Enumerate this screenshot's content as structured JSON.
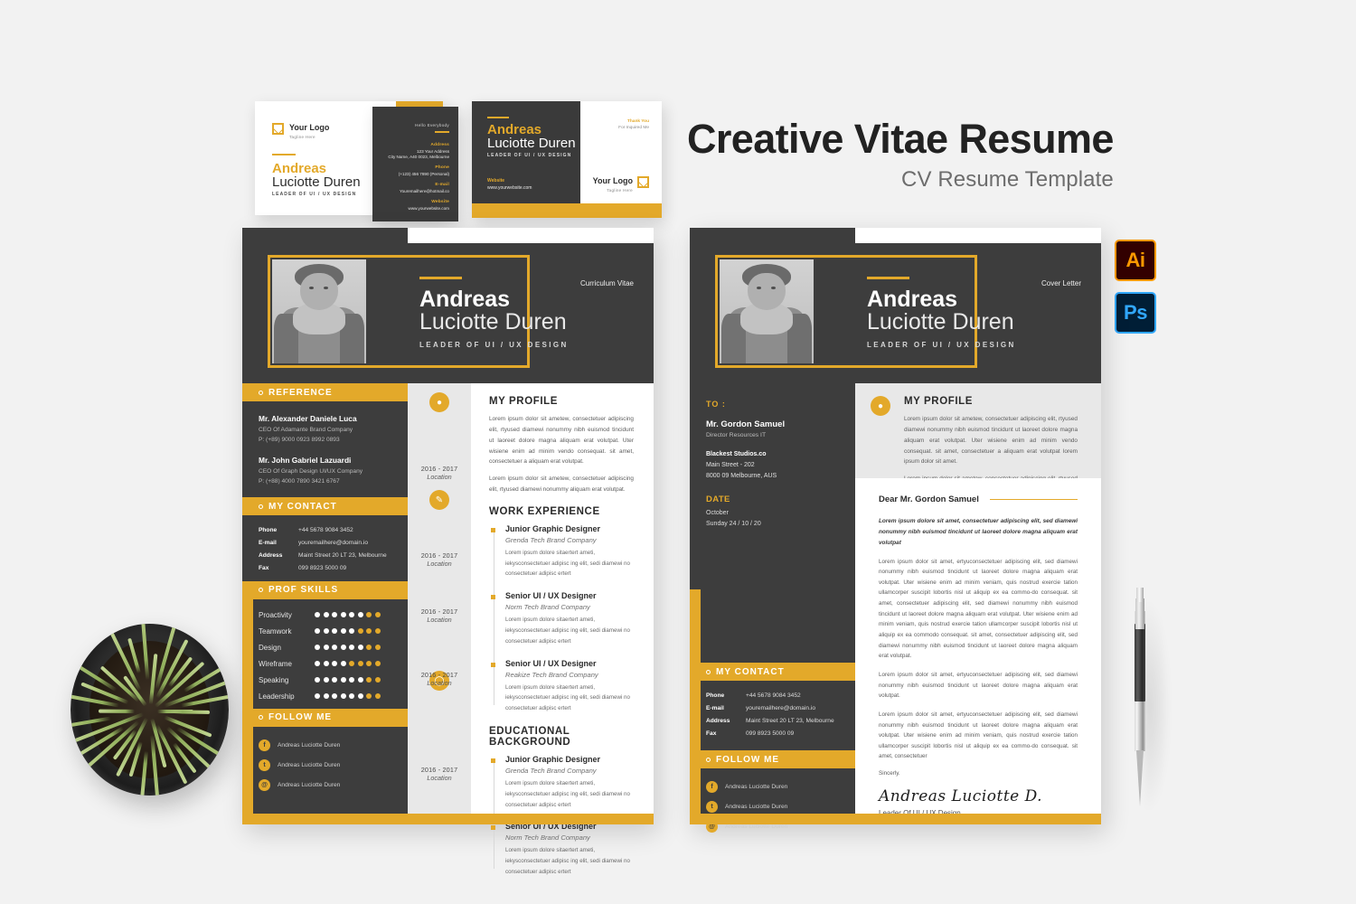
{
  "headline": {
    "title": "Creative Vitae Resume",
    "subtitle": "CV Resume Template"
  },
  "badges": [
    {
      "name": "illustrator-badge",
      "label": "Ai",
      "color": "#ff9a00"
    },
    {
      "name": "photoshop-badge",
      "label": "Ps",
      "color": "#31a8ff"
    }
  ],
  "brand": {
    "accent": "#e3a92a",
    "dark": "#3d3d3d",
    "light_gray": "#e8e8e8",
    "page_bg": "#f2f2f2"
  },
  "business_cards": {
    "front": {
      "logo_title": "Your Logo",
      "logo_tagline": "Tagline Here",
      "first_name": "Andreas",
      "last_name": "Luciotte Duren",
      "role": "LEADER OF UI / UX DESIGN"
    },
    "back_dark": {
      "hello": "Hello Everybody",
      "fields": [
        {
          "label": "Address",
          "value": "123 Your Address\nCity Name, A40 0023, Melbourne"
        },
        {
          "label": "Phone",
          "value": "(+123) 456 7890 (Personal)"
        },
        {
          "label": "E-mail",
          "value": "Youremailhere@hotmail.co"
        },
        {
          "label": "Website",
          "value": "www.yourwebsite.com"
        }
      ]
    },
    "wide": {
      "first_name": "Andreas",
      "last_name": "Luciotte Duren",
      "role": "LEADER OF UI / UX DESIGN",
      "website_label": "Website",
      "website_value": "www.yourwebsite.com",
      "thanks_line1": "Thank You",
      "thanks_line2": "For Inquired Me",
      "logo_title": "Your Logo",
      "logo_tagline": "Tagline Here"
    }
  },
  "cv": {
    "kicker": "Curriculum Vitae",
    "first_name": "Andreas",
    "last_name": "Luciotte Duren",
    "role": "LEADER OF UI / UX DESIGN",
    "sections": {
      "reference": "REFERENCE",
      "contact": "MY CONTACT",
      "skills": "PROF SKILLS",
      "follow": "FOLLOW ME",
      "profile": "MY PROFILE",
      "work": "WORK EXPERIENCE",
      "education": "EDUCATIONAL BACKGROUND"
    },
    "references": [
      {
        "name": "Mr. Alexander Daniele Luca",
        "role": "CEO Of Adamante Brand Company",
        "phone": "P: (+89) 9000 0923 8992 0893"
      },
      {
        "name": "Mr. John Gabriel Lazuardi",
        "role": "CEO Of Graph Design UI/UX Company",
        "phone": "P: (+88) 4000 7890 3421 6767"
      }
    ],
    "contact": [
      {
        "key": "Phone",
        "value": "+44 5678 9084 3452"
      },
      {
        "key": "E-mail",
        "value": "youremailhere@domain.io"
      },
      {
        "key": "Address",
        "value": "Maint Street 20 LT 23, Melbourne"
      },
      {
        "key": "Fax",
        "value": "099 8923 5000 09"
      }
    ],
    "skills": [
      {
        "name": "Proactivity",
        "filled": 6,
        "total": 8
      },
      {
        "name": "Teamwork",
        "filled": 5,
        "total": 8
      },
      {
        "name": "Design",
        "filled": 6,
        "total": 8
      },
      {
        "name": "Wireframe",
        "filled": 4,
        "total": 8
      },
      {
        "name": "Speaking",
        "filled": 6,
        "total": 8
      },
      {
        "name": "Leadership",
        "filled": 6,
        "total": 8
      }
    ],
    "follow": [
      {
        "icon": "facebook-icon",
        "glyph": "f",
        "handle": "Andreas Luciotte Duren"
      },
      {
        "icon": "twitter-icon",
        "glyph": "t",
        "handle": "Andreas Luciotte Duren"
      },
      {
        "icon": "instagram-icon",
        "glyph": "@",
        "handle": "Andreas Luciotte Duren"
      }
    ],
    "profile_paragraphs": [
      "Lorem ipsum dolor sit ametew, consectetuer adipiscing elit, rtyused diamewi nonummy nibh euismod tincidunt ut laoreet dolore magna aliquam erat volutpat. Uter wisiene enim ad minim vendo consequat. sit amet, consectetuer a aliquam erat volutpat.",
      "Lorem ipsum dolor sit ametew, consectetuer adipiscing elit, rtyused diamewi nonummy aliquam erat volutpat."
    ],
    "work": [
      {
        "title": "Junior Graphic Designer",
        "company": "Grenda Tech Brand Company",
        "desc": "Lorem ipsum dolore sitaertert ameti, iekysconsectetuer adipisc ing elit, sedi diamewi no consectetuer adipisc ertert"
      },
      {
        "title": "Senior UI / UX Designer",
        "company": "Norm Tech Brand Company",
        "desc": "Lorem ipsum dolore sitaertert ameti, iekysconsectetuer adipisc ing elit, sedi diamewi no consectetuer adipisc ertert"
      },
      {
        "title": "Senior UI / UX Designer",
        "company": "Reakize Tech Brand Company",
        "desc": "Lorem ipsum dolore sitaertert ameti, iekysconsectetuer adipisc ing elit, sedi diamewi no consectetuer adipisc ertert"
      }
    ],
    "education": [
      {
        "title": "Junior Graphic Designer",
        "company": "Grenda Tech Brand Company",
        "desc": "Lorem ipsum dolore sitaertert ameti, iekysconsectetuer adipisc ing elit, sedi diamewi no consectetuer adipisc ertert"
      },
      {
        "title": "Senior UI / UX Designer",
        "company": "Norm Tech Brand Company",
        "desc": "Lorem ipsum dolore sitaertert ameti, iekysconsectetuer adipisc ing elit, sedi diamewi no consectetuer adipisc ertert"
      }
    ],
    "timeline": [
      {
        "year": "2016 - 2017",
        "location": "Location"
      },
      {
        "year": "2016 - 2017",
        "location": "Location"
      },
      {
        "year": "2016 - 2017",
        "location": "Location"
      },
      {
        "year": "2016 - 2017",
        "location": "Location"
      },
      {
        "year": "2016 - 2017",
        "location": "Location"
      }
    ]
  },
  "cover_letter": {
    "kicker": "Cover Letter",
    "first_name": "Andreas",
    "last_name": "Luciotte Duren",
    "role": "LEADER OF UI / UX DESIGN",
    "to_label": "TO :",
    "recipient_name": "Mr. Gordon Samuel",
    "recipient_role": "Director Resources IT",
    "company": "Blackest Studios.co",
    "address_line1": "Main Street - 202",
    "address_line2": "8000 09 Melbourne, AUS",
    "date_label": "DATE",
    "date_month": "October",
    "date_full": "Sunday 24 / 10 / 20",
    "sections": {
      "profile": "MY PROFILE",
      "contact": "MY CONTACT",
      "follow": "FOLLOW ME"
    },
    "profile_paragraphs": [
      "Lorem ipsum dolor sit ametew, consectetuer adipiscing elit, rtyused diamewi nonummy nibh euismod tincidunt ut laoreet dolore magna aliquam erat volutpat. Uter wisiene enim ad minim vendo consequat. sit amet, consectetuer a aliquam erat volutpat lorem ipsum dolor sit amet.",
      "Lorem ipsum dolor sit ametew, consectetuer adipiscing elit, rtyused diamewi nonummy aliquam erat volutpat lorem ipsum dolor."
    ],
    "greeting": "Dear Mr. Gordon Samuel",
    "lead_paragraph": "Lorem ipsum dolore sit amet, consectetuer adipiscing elit, sed diamewi nonummy nibh euismod tincidunt ut laoreet dolore magna aliquam erat volutpat",
    "body_paragraphs": [
      "Lorem ipsum dolor sit amet, ertyuconsectetuer adipiscing elit, sed diamewi nonummy nibh euismod tincidunt ut laoreet dolore magna aliquam erat volutpat. Uter wisiene enim ad minim veniam, quis nostrud exercie tation ullamcorper suscipit lobortis nisl ut aliquip ex ea commo-do consequat. sit amet, consectetuer adipiscing elit, sed diamewi nonummy nibh euismod tincidunt ut laoreet dolore magna aliquam erat volutpat. Uter wisiene enim ad minim veniam, quis nostrud exercie tation ullamcorper suscipit lobortis nisl ut aliquip ex ea commodo consequat.  sit amet, consectetuer adipiscing elit, sed diamewi nonummy nibh euismod tincidunt ut laoreet dolore magna aliquam erat volutpat.",
      "Lorem ipsum dolor sit amet, ertyuconsectetuer adipiscing elit, sed diamewi nonummy nibh euismod tincidunt ut laoreet dolore magna aliquam erat volutpat.",
      "Lorem ipsum dolor sit amet, ertyuconsectetuer adipiscing elit, sed diamewi nonummy nibh euismod tincidunt ut laoreet dolore magna aliquam erat volutpat. Uter wisiene enim ad minim veniam, quis nostrud exercie tation ullamcorper suscipit lobortis nisl ut aliquip ex ea commo-do consequat. sit amet, consectetuer"
    ],
    "sincerely": "Sincerly.",
    "signature": "Andreas Luciotte D.",
    "signature_role": "Leader Of UI / UX Design",
    "contact": [
      {
        "key": "Phone",
        "value": "+44 5678 9084 3452"
      },
      {
        "key": "E-mail",
        "value": "youremailhere@domain.io"
      },
      {
        "key": "Address",
        "value": "Maint Street 20 LT 23, Melbourne"
      },
      {
        "key": "Fax",
        "value": "099 8923 5000 09"
      }
    ],
    "follow": [
      {
        "icon": "facebook-icon",
        "glyph": "f",
        "handle": "Andreas Luciotte Duren"
      },
      {
        "icon": "twitter-icon",
        "glyph": "t",
        "handle": "Andreas Luciotte Duren"
      },
      {
        "icon": "instagram-icon",
        "glyph": "@",
        "handle": "Andreas Luciotte Duren"
      }
    ]
  }
}
